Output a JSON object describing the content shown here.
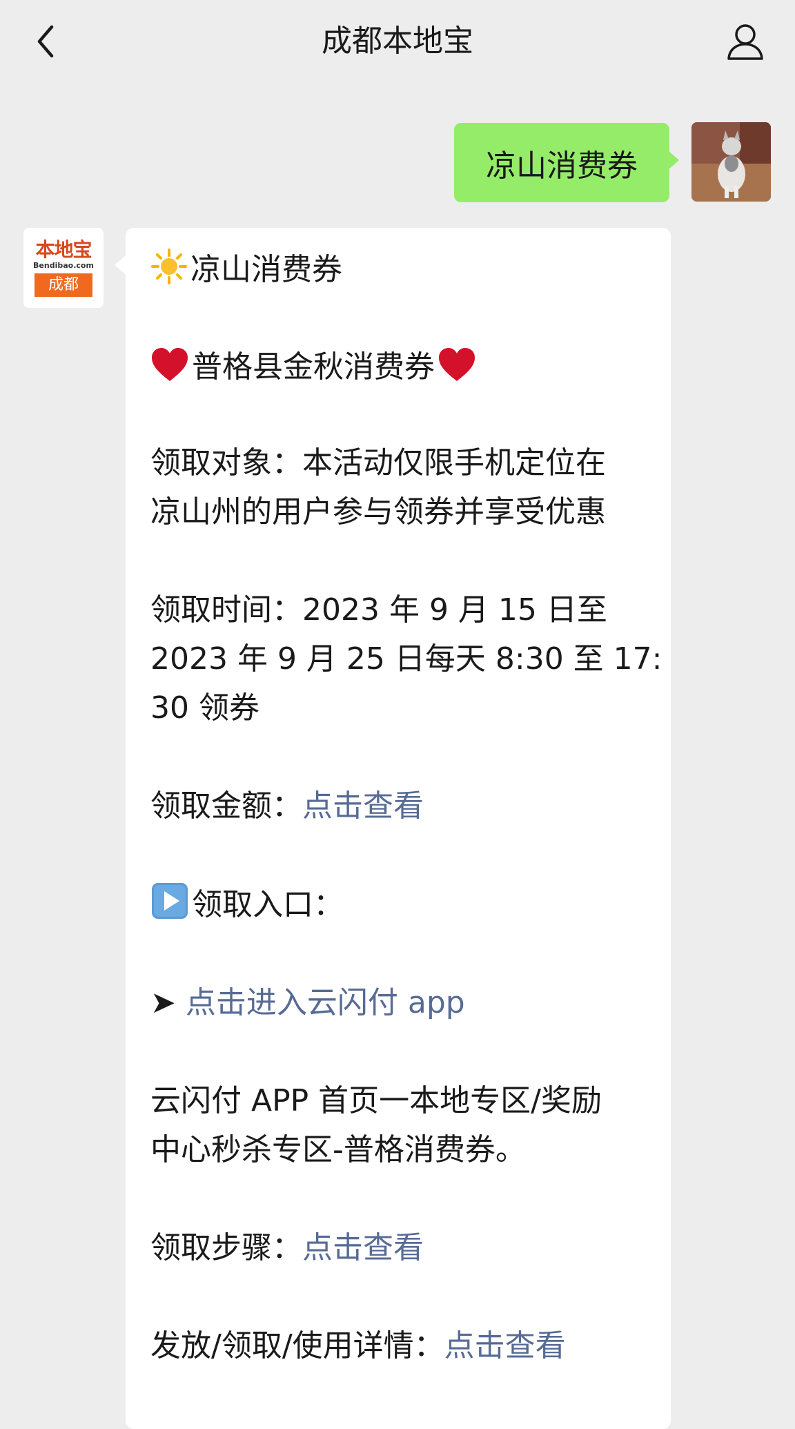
{
  "nav": {
    "title": "成都本地宝"
  },
  "chat": {
    "outgoing_text": "凉山消费券",
    "bot_logo": {
      "top": "本地宝",
      "mid": "Bendibao.com",
      "bottom": "成都"
    },
    "incoming": {
      "heading": "凉山消费券",
      "subtitle": "普格县金秋消费券",
      "target_line1": "领取对象：本活动仅限手机定位在",
      "target_line2": "凉山州的用户参与领券并享受优惠",
      "time_line1": "领取时间：2023 年 9 月 15 日至",
      "time_line2": "2023 年 9 月 25 日每天 8:30 至 17:",
      "time_line3": "30 领券",
      "amount_label": "领取金额：",
      "amount_link": "点击查看",
      "entry_label": "领取入口：",
      "app_arrow": "➤",
      "app_link": "点击进入云闪付 app",
      "path_line1": "云闪付 APP 首页一本地专区/奖励",
      "path_line2": "中心秒杀专区-普格消费券。",
      "steps_label": "领取步骤：",
      "steps_link": "点击查看",
      "details_label": "发放/领取/使用详情：",
      "details_link": "点击查看"
    }
  },
  "colors": {
    "background": "#ededed",
    "outgoing_bubble": "#95ec69",
    "incoming_bubble": "#ffffff",
    "link": "#576b95",
    "brand_orange": "#ef6a1f"
  },
  "icons": [
    "back-chevron-icon",
    "user-profile-icon",
    "sun-emoji-icon",
    "heart-emoji-icon",
    "play-button-emoji-icon"
  ]
}
